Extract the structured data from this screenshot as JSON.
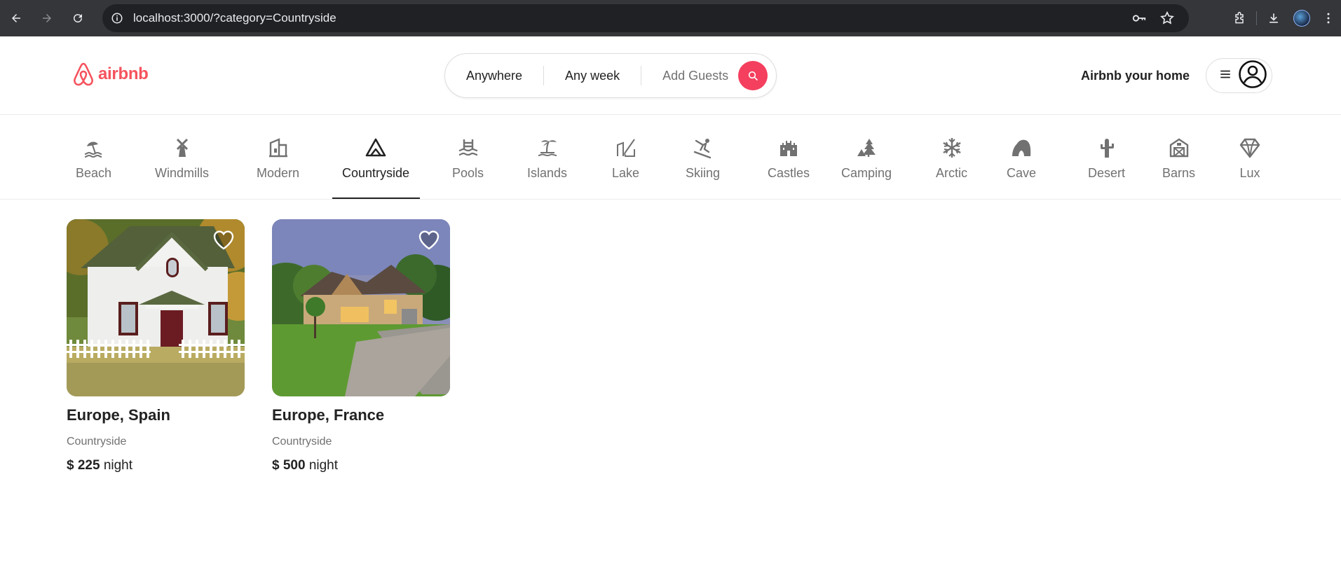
{
  "browser": {
    "url": "localhost:3000/?category=Countryside"
  },
  "header": {
    "logo_text": "airbnb",
    "search": {
      "where": "Anywhere",
      "when": "Any week",
      "guests": "Add Guests"
    },
    "host_link": "Airbnb your home"
  },
  "categories": [
    {
      "label": "Beach",
      "icon": "beach-icon"
    },
    {
      "label": "Windmills",
      "icon": "windmill-icon"
    },
    {
      "label": "Modern",
      "icon": "modern-icon"
    },
    {
      "label": "Countryside",
      "icon": "mountain-icon",
      "active": true
    },
    {
      "label": "Pools",
      "icon": "pool-icon"
    },
    {
      "label": "Islands",
      "icon": "island-icon"
    },
    {
      "label": "Lake",
      "icon": "lake-icon"
    },
    {
      "label": "Skiing",
      "icon": "skiing-icon"
    },
    {
      "label": "Castles",
      "icon": "castle-icon"
    },
    {
      "label": "Camping",
      "icon": "camping-icon"
    },
    {
      "label": "Arctic",
      "icon": "snowflake-icon"
    },
    {
      "label": "Cave",
      "icon": "cave-icon"
    },
    {
      "label": "Desert",
      "icon": "cactus-icon"
    },
    {
      "label": "Barns",
      "icon": "barn-icon"
    },
    {
      "label": "Lux",
      "icon": "diamond-icon"
    }
  ],
  "listings": [
    {
      "location": "Europe, Spain",
      "category": "Countryside",
      "price": "$ 225",
      "unit": "night"
    },
    {
      "location": "Europe, France",
      "category": "Countryside",
      "price": "$ 500",
      "unit": "night"
    }
  ],
  "colors": {
    "brand": "#f5535e",
    "search_button": "#f43f5e",
    "muted_text": "#717171"
  }
}
